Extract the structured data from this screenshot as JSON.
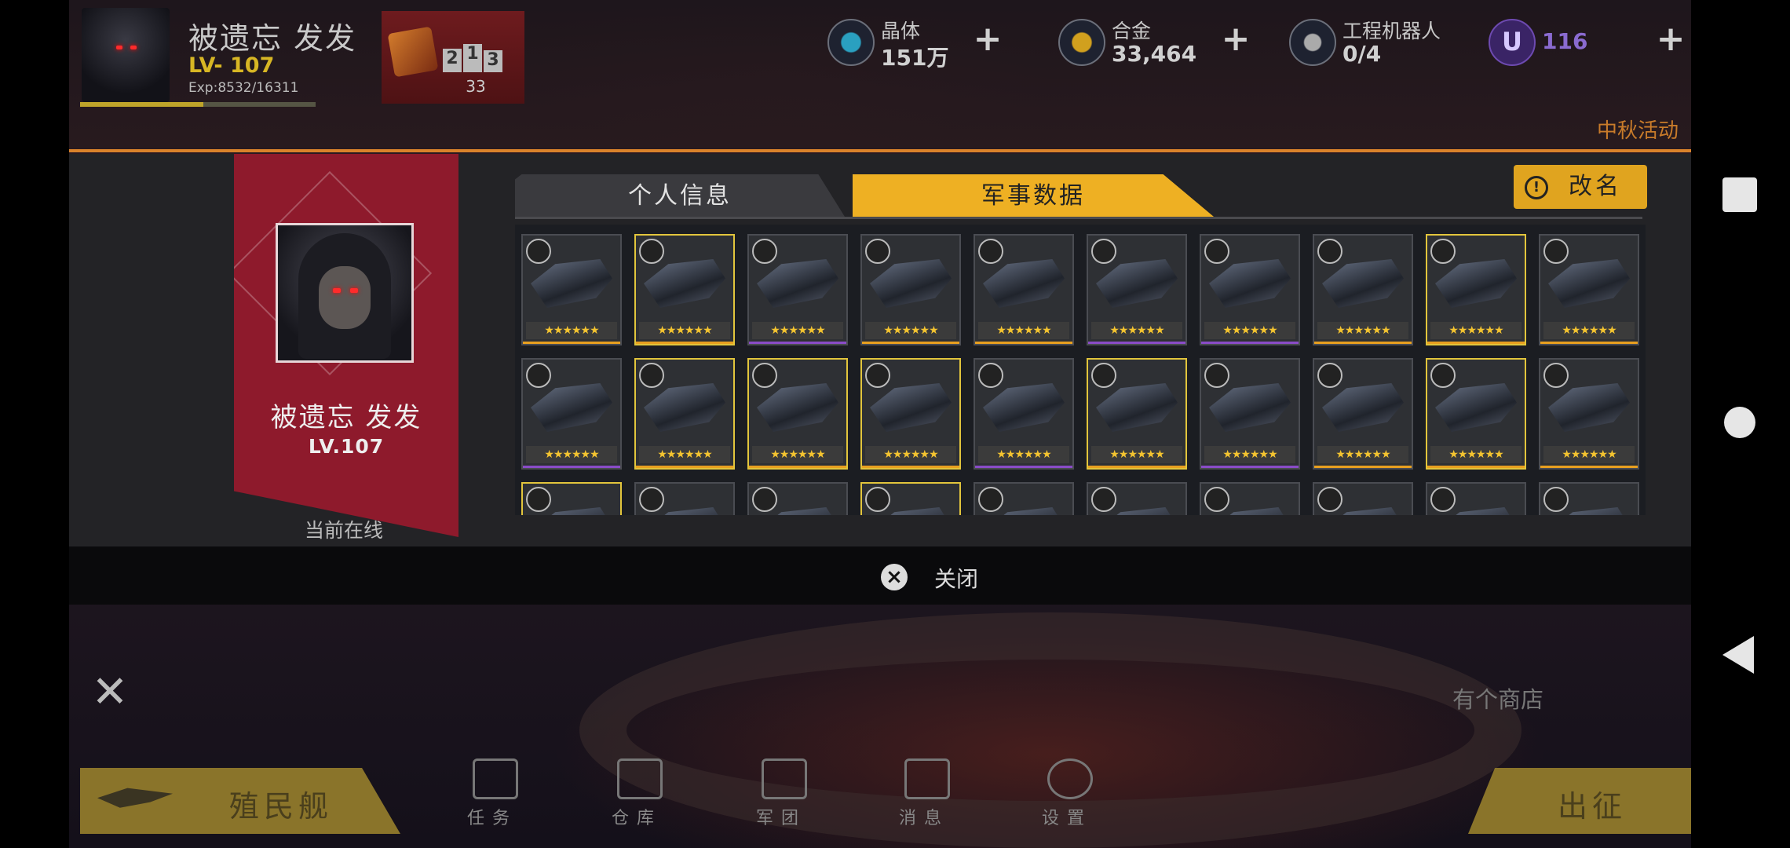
{
  "player": {
    "name": "被遗忘 发发",
    "level_label": "LV- 107",
    "exp_label": "Exp:8532/16311",
    "exp_progress": 0.523
  },
  "rank": {
    "podium": [
      "2",
      "1",
      "3"
    ],
    "count": "33"
  },
  "resources": [
    {
      "label": "晶体",
      "value": "151万",
      "icon": "crystal-icon"
    },
    {
      "label": "合金",
      "value": "33,464",
      "icon": "alloy-icon"
    },
    {
      "label": "工程机器人",
      "value": "0/4",
      "icon": "robot-icon"
    },
    {
      "label": "",
      "value": "116",
      "icon": "u-currency-icon"
    }
  ],
  "event_label": "中秋活动",
  "profile": {
    "name": "被遗忘 发发",
    "level": "LV.107",
    "status": "当前在线"
  },
  "tabs": [
    {
      "label": "个人信息",
      "active": false
    },
    {
      "label": "军事数据",
      "active": true
    }
  ],
  "rename_label": "改名",
  "ships": [
    {
      "stars": "★★★★★★",
      "border": "normal",
      "rarity": "#e8a020"
    },
    {
      "stars": "★★★★★★",
      "border": "gold",
      "rarity": "#e8a020"
    },
    {
      "stars": "★★★★★★",
      "border": "normal",
      "rarity": "#8a4cc8"
    },
    {
      "stars": "★★★★★★",
      "border": "normal",
      "rarity": "#e8a020"
    },
    {
      "stars": "★★★★★★",
      "border": "normal",
      "rarity": "#e8a020"
    },
    {
      "stars": "★★★★★★",
      "border": "normal",
      "rarity": "#8a4cc8"
    },
    {
      "stars": "★★★★★★",
      "border": "normal",
      "rarity": "#8a4cc8"
    },
    {
      "stars": "★★★★★★",
      "border": "normal",
      "rarity": "#e8a020"
    },
    {
      "stars": "★★★★★★",
      "border": "gold",
      "rarity": "#e8a020"
    },
    {
      "stars": "★★★★★★",
      "border": "normal",
      "rarity": "#e8a020"
    },
    {
      "stars": "★★★★★★",
      "border": "normal",
      "rarity": "#8a4cc8"
    },
    {
      "stars": "★★★★★★",
      "border": "gold",
      "rarity": "#e8a020"
    },
    {
      "stars": "★★★★★★",
      "border": "gold",
      "rarity": "#e8a020"
    },
    {
      "stars": "★★★★★★",
      "border": "gold",
      "rarity": "#e8a020"
    },
    {
      "stars": "★★★★★★",
      "border": "normal",
      "rarity": "#8a4cc8"
    },
    {
      "stars": "★★★★★★",
      "border": "gold",
      "rarity": "#e8a020"
    },
    {
      "stars": "★★★★★★",
      "border": "normal",
      "rarity": "#8a4cc8"
    },
    {
      "stars": "★★★★★★",
      "border": "normal",
      "rarity": "#e8a020"
    },
    {
      "stars": "★★★★★★",
      "border": "gold",
      "rarity": "#e8a020"
    },
    {
      "stars": "★★★★★★",
      "border": "normal",
      "rarity": "#e8a020"
    },
    {
      "stars": "",
      "border": "gold",
      "rarity": ""
    },
    {
      "stars": "",
      "border": "normal",
      "rarity": ""
    },
    {
      "stars": "",
      "border": "normal",
      "rarity": ""
    },
    {
      "stars": "",
      "border": "gold",
      "rarity": ""
    },
    {
      "stars": "",
      "border": "normal",
      "rarity": ""
    },
    {
      "stars": "",
      "border": "normal",
      "rarity": ""
    },
    {
      "stars": "",
      "border": "normal",
      "rarity": ""
    },
    {
      "stars": "",
      "border": "normal",
      "rarity": ""
    },
    {
      "stars": "",
      "border": "normal",
      "rarity": ""
    },
    {
      "stars": "",
      "border": "normal",
      "rarity": ""
    }
  ],
  "close_label": "关闭",
  "shop_label": "有个商店",
  "colony_label": "殖民舰",
  "nav": [
    {
      "label": "任务",
      "icon": "task-icon"
    },
    {
      "label": "仓库",
      "icon": "warehouse-icon"
    },
    {
      "label": "军团",
      "icon": "legion-icon"
    },
    {
      "label": "消息",
      "icon": "message-icon"
    },
    {
      "label": "设置",
      "icon": "settings-icon"
    }
  ],
  "sortie_label": "出征",
  "colors": {
    "accent": "#eeb023",
    "card": "#8e1a2c",
    "star": "#f4c430",
    "gold_border": "#e2c53c"
  }
}
